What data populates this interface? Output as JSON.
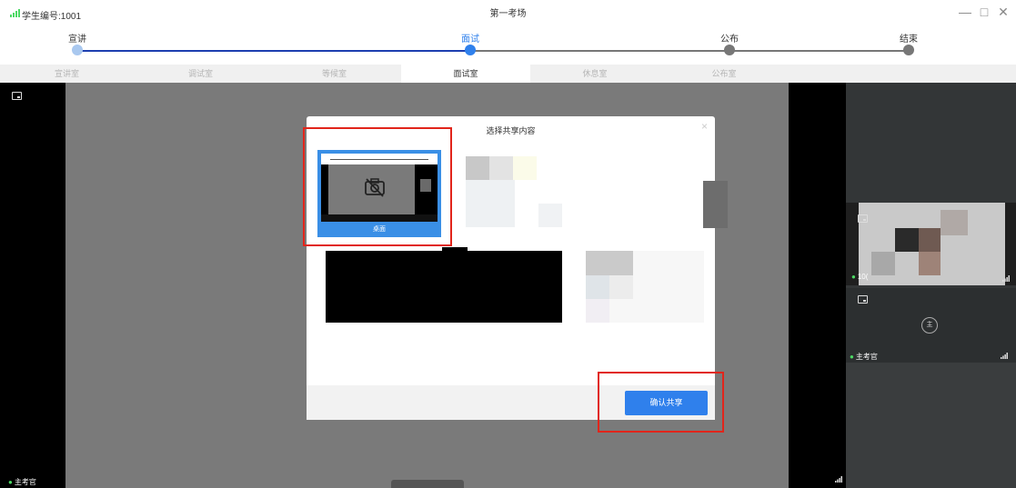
{
  "titlebar": {
    "student_id": "学生编号:1001",
    "venue": "第一考场",
    "minimize": "—",
    "maximize": "□",
    "close": "✕"
  },
  "steps": [
    {
      "label": "宣讲",
      "state": "done"
    },
    {
      "label": "面试",
      "state": "current"
    },
    {
      "label": "公布",
      "state": "pending"
    },
    {
      "label": "结束",
      "state": "pending"
    }
  ],
  "tabs": [
    {
      "label": "宣讲室",
      "active": false
    },
    {
      "label": "调试室",
      "active": false
    },
    {
      "label": "等候室",
      "active": false
    },
    {
      "label": "面试室",
      "active": true
    },
    {
      "label": "休息室",
      "active": false
    },
    {
      "label": "公布室",
      "active": false
    }
  ],
  "stage": {
    "left_mic_label": "主考官",
    "right_volume": "10(",
    "right_mic_label": "主考官",
    "avatar_text": "主"
  },
  "dialog": {
    "title": "选择共享内容",
    "close": "×",
    "desktop_label": "桌面",
    "confirm_label": "确认共享"
  },
  "colors": {
    "accent": "#2f80ec",
    "step_done": "#a9c8ef",
    "step_pending": "#777777",
    "highlight": "#e1251b"
  },
  "icons": {
    "signal": "signal-bars-icon",
    "screen": "screen-share-icon",
    "mic": "microphone-icon",
    "camera_off": "camera-off-icon"
  }
}
